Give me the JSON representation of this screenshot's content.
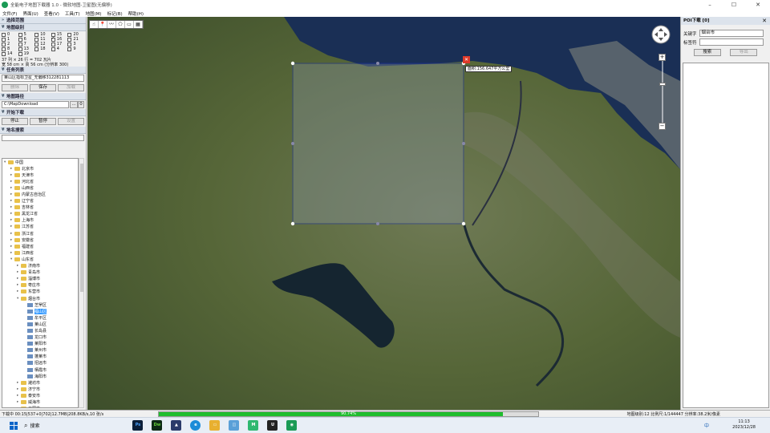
{
  "window": {
    "title": "全能电子地图下载器 1.0 - 微软地图-卫星图(无偏移)",
    "minimize": "–",
    "maximize": "☐",
    "close": "✕"
  },
  "menu": [
    "文件(F)",
    "界面(U)",
    "查看(V)",
    "工具(T)",
    "地图(M)",
    "标记(B)",
    "帮助(H)"
  ],
  "left": {
    "sec_range": "选择范围",
    "sec_levels": "地图级别",
    "levels": [
      {
        "n": "0",
        "on": false
      },
      {
        "n": "5",
        "on": false
      },
      {
        "n": "10",
        "on": false
      },
      {
        "n": "15",
        "on": false
      },
      {
        "n": "20",
        "on": false
      },
      {
        "n": "1",
        "on": false
      },
      {
        "n": "6",
        "on": false
      },
      {
        "n": "11",
        "on": false
      },
      {
        "n": "16",
        "on": true
      },
      {
        "n": "21",
        "on": false
      },
      {
        "n": "2",
        "on": false
      },
      {
        "n": "7",
        "on": false
      },
      {
        "n": "12",
        "on": false
      },
      {
        "n": "17",
        "on": false
      },
      {
        "n": "3",
        "on": false
      },
      {
        "n": "8",
        "on": false
      },
      {
        "n": "13",
        "on": false
      },
      {
        "n": "18",
        "on": false
      },
      {
        "n": "4",
        "on": false
      },
      {
        "n": "9",
        "on": false
      },
      {
        "n": "14",
        "on": false
      },
      {
        "n": "19",
        "on": false
      }
    ],
    "stats_line1": "37 列 × 26 行 = 702 瓦片",
    "stats_line2": "宽 58 cm × 高 56 cm (分辨率 300)",
    "sec_tasks": "任务列表",
    "task_select": "莱山区指标卫星_无偏移312281113",
    "btn_delete": "删除",
    "btn_save": "保存",
    "btn_load": "加载",
    "sec_path": "地图路径",
    "path_value": "C:\\MapDownload",
    "btn_browse": "...",
    "btn_open": "0",
    "sec_start": "开始下载",
    "btn_stop": "停止",
    "btn_pause": "暂停",
    "btn_settings": "设置",
    "sec_search": "地名搜索",
    "tree": [
      {
        "d": 0,
        "t": "▾",
        "k": "fo",
        "l": "中国"
      },
      {
        "d": 1,
        "t": "▸",
        "k": "fo",
        "l": "北京市"
      },
      {
        "d": 1,
        "t": "▸",
        "k": "fo",
        "l": "天津市"
      },
      {
        "d": 1,
        "t": "▸",
        "k": "fo",
        "l": "河北省"
      },
      {
        "d": 1,
        "t": "▸",
        "k": "fo",
        "l": "山西省"
      },
      {
        "d": 1,
        "t": "▸",
        "k": "fo",
        "l": "内蒙古自治区"
      },
      {
        "d": 1,
        "t": "▸",
        "k": "fo",
        "l": "辽宁省"
      },
      {
        "d": 1,
        "t": "▸",
        "k": "fo",
        "l": "吉林省"
      },
      {
        "d": 1,
        "t": "▸",
        "k": "fo",
        "l": "黑龙江省"
      },
      {
        "d": 1,
        "t": "▸",
        "k": "fo",
        "l": "上海市"
      },
      {
        "d": 1,
        "t": "▸",
        "k": "fo",
        "l": "江苏省"
      },
      {
        "d": 1,
        "t": "▸",
        "k": "fo",
        "l": "浙江省"
      },
      {
        "d": 1,
        "t": "▸",
        "k": "fo",
        "l": "安徽省"
      },
      {
        "d": 1,
        "t": "▸",
        "k": "fo",
        "l": "福建省"
      },
      {
        "d": 1,
        "t": "▸",
        "k": "fo",
        "l": "江西省"
      },
      {
        "d": 1,
        "t": "▾",
        "k": "fo",
        "l": "山东省"
      },
      {
        "d": 2,
        "t": "▸",
        "k": "fo",
        "l": "济南市"
      },
      {
        "d": 2,
        "t": "▸",
        "k": "fo",
        "l": "青岛市"
      },
      {
        "d": 2,
        "t": "▸",
        "k": "fo",
        "l": "淄博市"
      },
      {
        "d": 2,
        "t": "▸",
        "k": "fo",
        "l": "枣庄市"
      },
      {
        "d": 2,
        "t": "▸",
        "k": "fo",
        "l": "东营市"
      },
      {
        "d": 2,
        "t": "▾",
        "k": "fo",
        "l": "烟台市"
      },
      {
        "d": 3,
        "t": "",
        "k": "ci",
        "l": "芝罘区"
      },
      {
        "d": 3,
        "t": "",
        "k": "ci",
        "l": "福山区",
        "sel": true
      },
      {
        "d": 3,
        "t": "",
        "k": "ci",
        "l": "牟平区"
      },
      {
        "d": 3,
        "t": "",
        "k": "ci",
        "l": "莱山区"
      },
      {
        "d": 3,
        "t": "",
        "k": "ci",
        "l": "长岛县"
      },
      {
        "d": 3,
        "t": "",
        "k": "ci",
        "l": "龙口市"
      },
      {
        "d": 3,
        "t": "",
        "k": "ci",
        "l": "莱阳市"
      },
      {
        "d": 3,
        "t": "",
        "k": "ci",
        "l": "莱州市"
      },
      {
        "d": 3,
        "t": "",
        "k": "ci",
        "l": "蓬莱市"
      },
      {
        "d": 3,
        "t": "",
        "k": "ci",
        "l": "招远市"
      },
      {
        "d": 3,
        "t": "",
        "k": "ci",
        "l": "栖霞市"
      },
      {
        "d": 3,
        "t": "",
        "k": "ci",
        "l": "海阳市"
      },
      {
        "d": 2,
        "t": "▸",
        "k": "fo",
        "l": "潍坊市"
      },
      {
        "d": 2,
        "t": "▸",
        "k": "fo",
        "l": "济宁市"
      },
      {
        "d": 2,
        "t": "▸",
        "k": "fo",
        "l": "泰安市"
      },
      {
        "d": 2,
        "t": "▸",
        "k": "fo",
        "l": "威海市"
      },
      {
        "d": 2,
        "t": "▸",
        "k": "fo",
        "l": "日照市"
      }
    ]
  },
  "map": {
    "tools": [
      "☝",
      "📍",
      "〰",
      "⬠",
      "▭",
      "▦"
    ],
    "area_label": "面积:156.647平方公里",
    "close_mark": "✕",
    "zoom_in": "+",
    "zoom_out": "−"
  },
  "right": {
    "title": "POI下载 [0]",
    "close": "✕",
    "keyword_label": "关键字",
    "keyword_value": "烟台市",
    "tag_label": "标签符",
    "tag_value": "",
    "btn_search": "搜索",
    "btn_export": "导出"
  },
  "status": {
    "left": "下载中 00:15|537+0|702|12.7MB|208.8KB/s,10 张/s",
    "progress_text": "90.74%",
    "progress": 0.9074,
    "right": "地图级别:12 比例尺:1/144447 分辨率:38.2米/像素"
  },
  "taskbar": {
    "search": "搜索",
    "time": "11:13",
    "date": "2023/12/28",
    "ime": "中"
  }
}
